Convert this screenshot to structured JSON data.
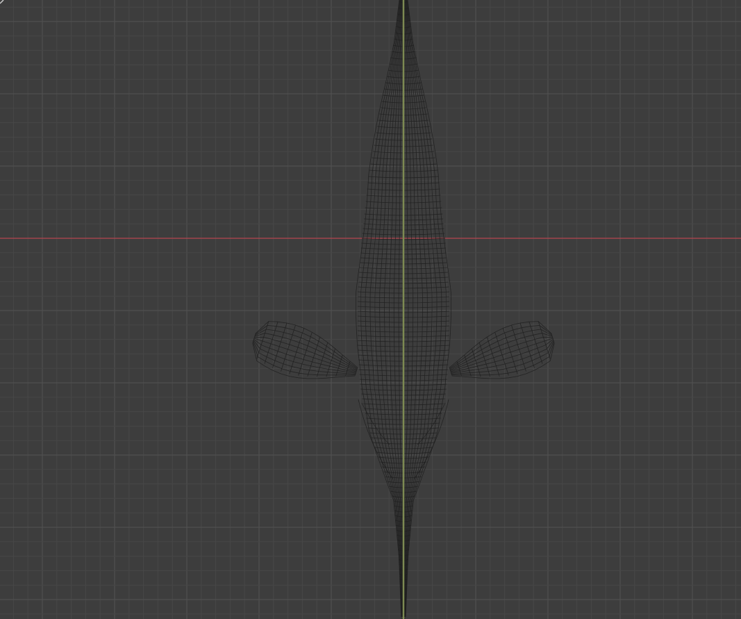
{
  "viewport": {
    "mode": "wireframe",
    "view": "top-orthographic",
    "colors": {
      "background": "#3d3d3d",
      "grid_minor": "#474747",
      "grid_major": "#525252",
      "x_axis": "#b5454f",
      "wire": "#1e1e1e",
      "spine": "#7d8a52"
    }
  }
}
